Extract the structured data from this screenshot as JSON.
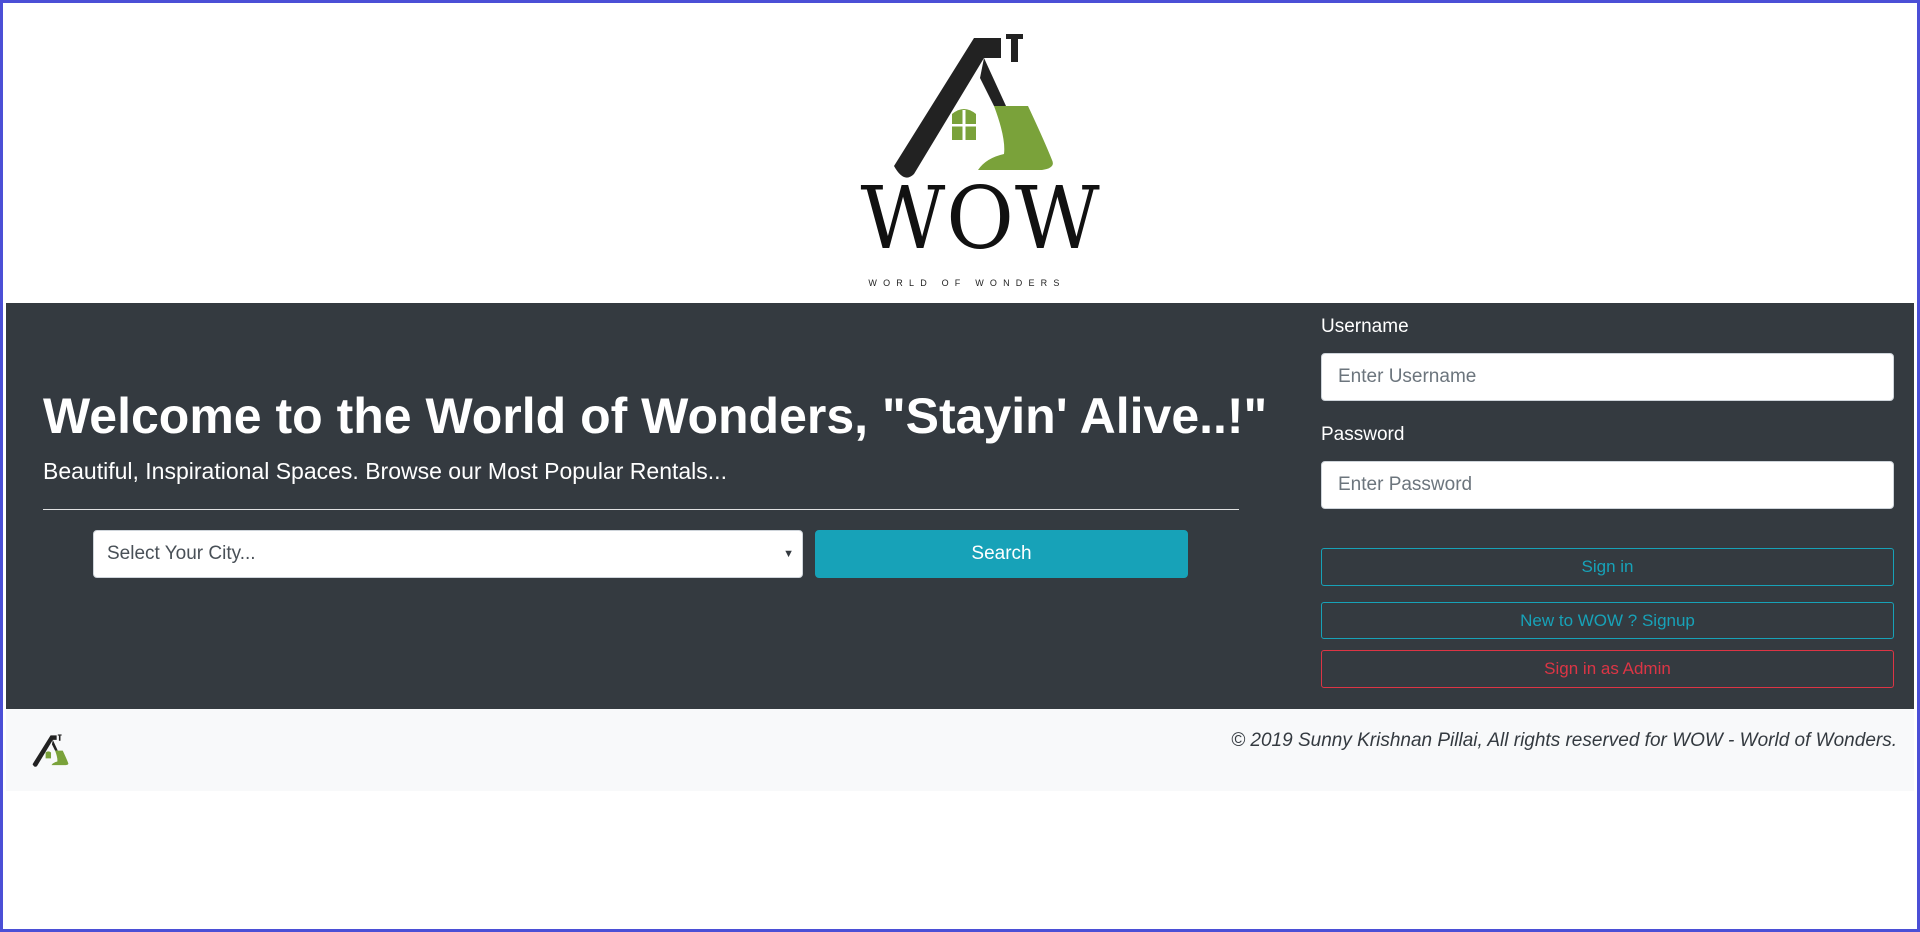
{
  "brand": {
    "wordmark": "WOW",
    "tagline": "WORLD OF WONDERS",
    "colors": {
      "logo_dark": "#222222",
      "logo_green": "#7aa23a"
    }
  },
  "hero": {
    "title": "Welcome to the World of Wonders, \"Stayin' Alive..!\"",
    "subtitle": "Beautiful, Inspirational Spaces. Browse our Most Popular Rentals...",
    "city_select": {
      "placeholder": "Select Your City...",
      "caret_icon": "caret-down-icon"
    },
    "search_label": "Search",
    "colors": {
      "background": "#343a40",
      "search_button": "#17a2b8"
    }
  },
  "login": {
    "username_label": "Username",
    "username_placeholder": "Enter Username",
    "password_label": "Password",
    "password_placeholder": "Enter Password",
    "signin_label": "Sign in",
    "signup_label": "New to WOW ? Signup",
    "admin_label": "Sign in as Admin",
    "colors": {
      "info": "#17a2b8",
      "danger": "#dc3545"
    }
  },
  "footer": {
    "copyright": "© 2019 Sunny Krishnan Pillai, All rights reserved for WOW - World of Wonders."
  }
}
